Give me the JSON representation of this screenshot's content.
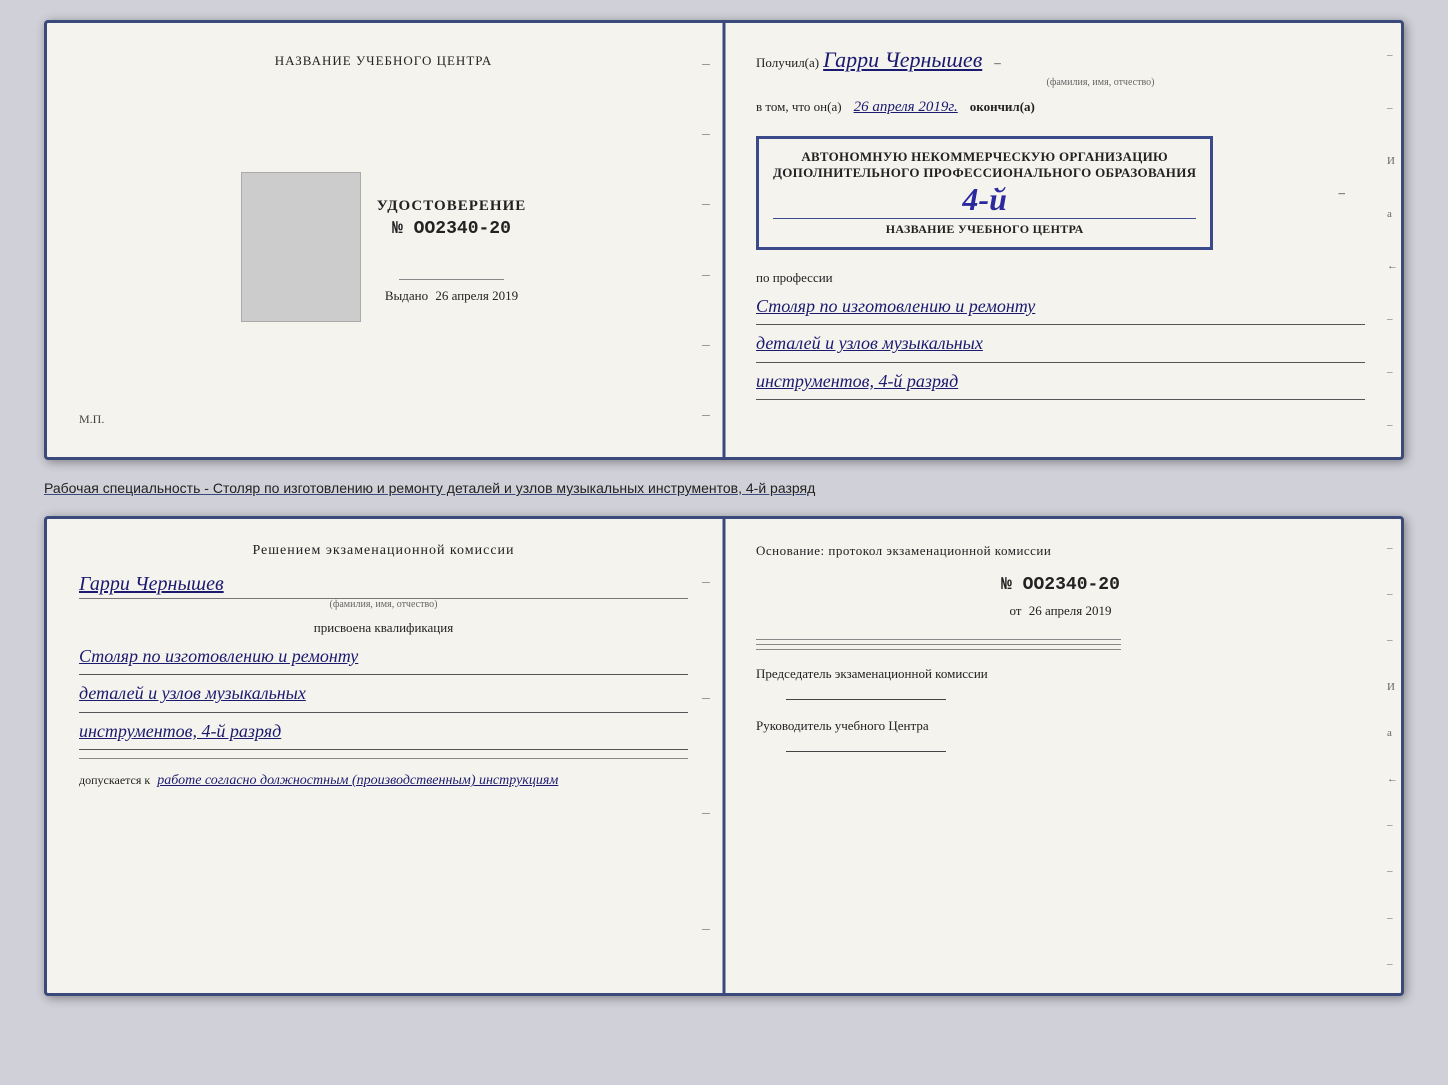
{
  "top_spread": {
    "left": {
      "header": "НАЗВАНИЕ УЧЕБНОГО ЦЕНТРА",
      "udostoverenie_title": "УДОСТОВЕРЕНИЕ",
      "udostoverenie_number": "№ OO2340-20",
      "vydano_label": "Выдано",
      "vydano_date": "26 апреля 2019",
      "mp_label": "М.П."
    },
    "right": {
      "poluchil_label": "Получил(а)",
      "recipient_name": "Гарри Чернышев",
      "name_subtitle": "(фамилия, имя, отчество)",
      "vtom_label": "в том, что он(а)",
      "completion_date": "26 апреля 2019г.",
      "okonchil_label": "окончил(а)",
      "stamp_line1": "АВТОНОМНУЮ НЕКОММЕРЧЕСКУЮ ОРГАНИЗАЦИЮ",
      "stamp_line2": "ДОПОЛНИТЕЛЬНОГО ПРОФЕССИОНАЛЬНОГО ОБРАЗОВАНИЯ",
      "stamp_number": "4-й",
      "stamp_center": "НАЗВАНИЕ УЧЕБНОГО ЦЕНТРА",
      "po_professii_label": "по профессии",
      "profession_line1": "Столяр по изготовлению и ремонту",
      "profession_line2": "деталей и узлов музыкальных",
      "profession_line3": "инструментов, 4-й разряд"
    }
  },
  "subtitle": "Рабочая специальность - Столяр по изготовлению и ремонту деталей и узлов музыкальных инструментов, 4-й разряд",
  "bottom_spread": {
    "left": {
      "resheniem_header": "Решением  экзаменационной  комиссии",
      "recipient_name": "Гарри Чернышев",
      "name_subtitle": "(фамилия, имя, отчество)",
      "prisvoena_label": "присвоена квалификация",
      "profession_line1": "Столяр по изготовлению и ремонту",
      "profession_line2": "деталей и узлов музыкальных",
      "profession_line3": "инструментов, 4-й разряд",
      "dopuskaetsya_label": "допускается к",
      "dopuskaetsya_value": "работе согласно должностным (производственным) инструкциям"
    },
    "right": {
      "osnovanie_header": "Основание: протокол экзаменационной  комиссии",
      "protocol_number": "№  OO2340-20",
      "ot_label": "от",
      "ot_date": "26 апреля 2019",
      "predsedatel_label": "Председатель экзаменационной комиссии",
      "rukovoditel_label": "Руководитель учебного Центра"
    }
  },
  "spine_marks": {
    "right_labels": [
      "И",
      "а",
      "←",
      "–",
      "–",
      "–",
      "–",
      "–"
    ]
  }
}
